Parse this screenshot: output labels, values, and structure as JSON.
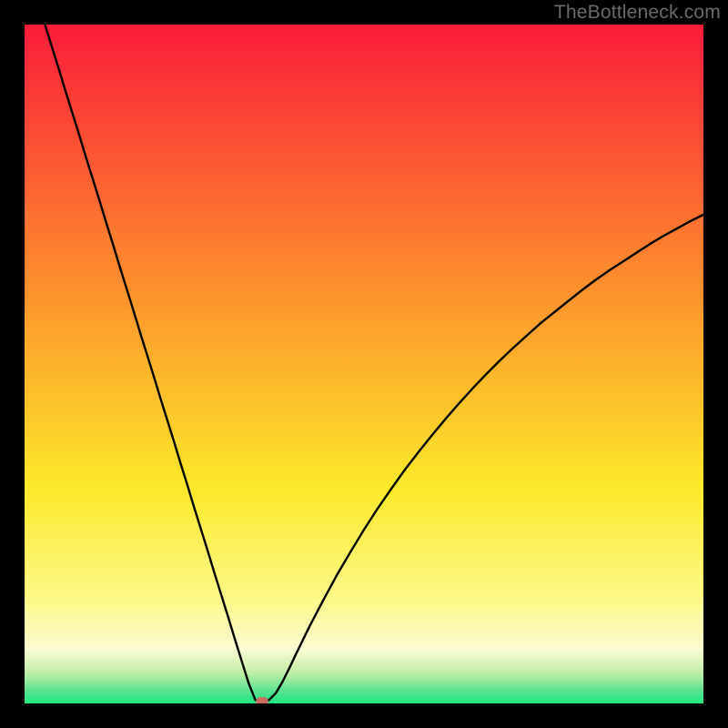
{
  "watermark": "TheBottleneck.com",
  "colors": {
    "top": "#fb1c3a",
    "mid1": "#fd8e2d",
    "mid2": "#fce829",
    "low": "#fbfbd3",
    "bottom": "#1ee87e",
    "curve": "#000000",
    "marker": "#c86d60",
    "frame": "#000000"
  },
  "chart_data": {
    "type": "line",
    "title": "",
    "xlabel": "",
    "ylabel": "",
    "xlim": [
      0,
      100
    ],
    "ylim": [
      0,
      100
    ],
    "x": [
      3,
      4,
      5,
      6,
      7,
      8,
      9,
      10,
      11,
      12,
      13,
      14,
      15,
      16,
      17,
      18,
      19,
      20,
      21,
      22,
      23,
      24,
      25,
      26,
      27,
      28,
      29,
      30,
      31,
      32,
      33,
      34,
      35,
      36,
      37,
      38,
      39,
      40,
      42,
      44,
      46,
      48,
      50,
      52,
      54,
      56,
      58,
      60,
      62,
      64,
      66,
      68,
      70,
      72,
      74,
      76,
      78,
      80,
      82,
      84,
      86,
      88,
      90,
      92,
      94,
      96,
      98,
      100
    ],
    "values": [
      100,
      96.8,
      93.6,
      90.3,
      87.1,
      83.9,
      80.6,
      77.4,
      74.2,
      70.9,
      67.7,
      64.4,
      61.2,
      58.0,
      54.7,
      51.5,
      48.3,
      45.0,
      41.8,
      38.6,
      35.3,
      32.1,
      28.8,
      25.6,
      22.4,
      19.1,
      15.9,
      12.7,
      9.4,
      6.2,
      3.0,
      0.5,
      0.3,
      0.5,
      1.5,
      3.2,
      5.2,
      7.3,
      11.4,
      15.2,
      18.9,
      22.3,
      25.6,
      28.7,
      31.6,
      34.4,
      37.0,
      39.5,
      41.9,
      44.2,
      46.4,
      48.5,
      50.5,
      52.4,
      54.2,
      56.0,
      57.6,
      59.2,
      60.8,
      62.3,
      63.7,
      65.0,
      66.3,
      67.6,
      68.8,
      69.9,
      71.0,
      72.0
    ],
    "grid": false,
    "legend": false,
    "marker_point": {
      "x": 35,
      "y": 0.3
    },
    "gradient_stops": [
      {
        "pos": 0.0,
        "color": "#fb1c3a"
      },
      {
        "pos": 0.38,
        "color": "#fd8e2d"
      },
      {
        "pos": 0.68,
        "color": "#fce829"
      },
      {
        "pos": 0.85,
        "color": "#fcfa8a"
      },
      {
        "pos": 0.92,
        "color": "#fbfbd3"
      },
      {
        "pos": 0.955,
        "color": "#c1eea6"
      },
      {
        "pos": 0.985,
        "color": "#4ee28f"
      },
      {
        "pos": 1.0,
        "color": "#1ee87e"
      }
    ]
  }
}
